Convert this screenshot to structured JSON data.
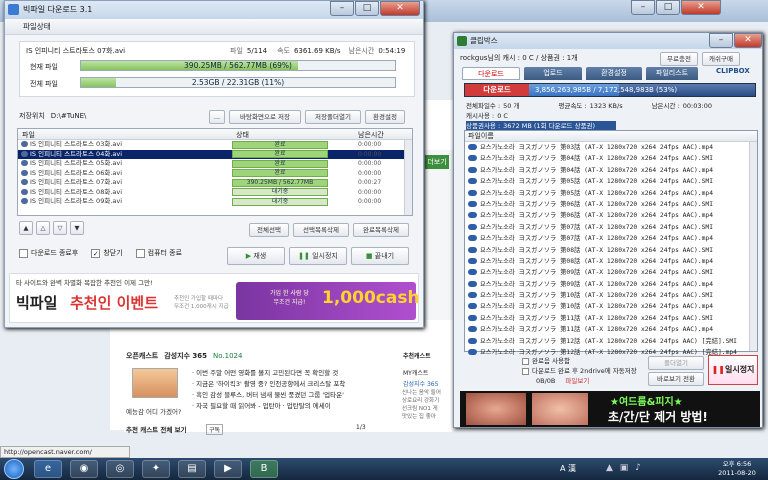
{
  "bigfile": {
    "title": "빅파일 다운로드 3.1",
    "section_label": "파일상태",
    "current_file_name": "IS 인피니티 스트라토스 07화.avi",
    "file_count_label": "파일",
    "file_count": "5/114",
    "speed_label": "속도",
    "speed": "6361.69 KB/s",
    "remain_label": "남은시간",
    "remain": "0:54:19",
    "current_file_label": "현재 파일",
    "current_progress_text": "390.25MB / 562.77MB (69%)",
    "current_progress": 0.69,
    "total_file_label": "전체 파일",
    "total_progress_text": "2.53GB / 22.31GB (11%)",
    "total_progress": 0.11,
    "save_location_label": "저장위치",
    "save_path": "D:\\#TuNE\\",
    "browse_label": "...",
    "btn_icon_save": "바탕화면으로 저장",
    "btn_folder_save": "저장폴더열기",
    "btn_settings": "환경설정",
    "col_file": "파일",
    "col_status": "상태",
    "col_remain": "남은시간",
    "rows": [
      {
        "name": "IS 인피니티 스트라토스 03화.avi",
        "status": "완료",
        "time": "0:00:00",
        "progress": 1
      },
      {
        "name": "IS 인피니티 스트라토스 04화.avi",
        "status": "완료",
        "time": "0:00:00",
        "progress": 1
      },
      {
        "name": "IS 인피니티 스트라토스 05화.avi",
        "status": "완료",
        "time": "0:00:00",
        "progress": 1
      },
      {
        "name": "IS 인피니티 스트라토스 06화.avi",
        "status": "완료",
        "time": "0:00:00",
        "progress": 1
      },
      {
        "name": "IS 인피니티 스트라토스 07화.avi",
        "status": "390.25MB / 562.77MB",
        "time": "0:00:27",
        "progress": 0.69
      },
      {
        "name": "IS 인피니티 스트라토스 08화.avi",
        "status": "대기중",
        "time": "0:00:00",
        "progress": 0
      },
      {
        "name": "IS 인피니티 스트라토스 09화.avi",
        "status": "대기중",
        "time": "0:00:00",
        "progress": 0
      }
    ],
    "btn_select_all": "전체선택",
    "btn_delete_selected": "선택목록삭제",
    "btn_delete_done": "완료목록삭제",
    "chk_close": "다운로드 종료후",
    "chk_minimize": "창닫기",
    "chk_shutdown": "컴퓨터 종료",
    "btn_play": "재생",
    "btn_pause": "일시정지",
    "btn_close": "끝내기",
    "ad_top": "타 사이트와 완벽 차별화 복잡한 추천인 이제 그만!",
    "ad_brand": "빅파일",
    "ad_main": "추천인 이벤트",
    "ad_sub": "추천인 가입할 때마다\n무조건 1,000캐시 지급",
    "ad_promo": "가입 한 사람 당\n무조건 지급!",
    "ad_cash": "1,000cash"
  },
  "clipbox": {
    "title": "클립박스",
    "user_line": "rockgus님의 캐시 : 0 C / 상품권 : 1개",
    "btn_charge": "무료충전",
    "btn_cash_charge": "캐쉬구매",
    "tabs": [
      "다운로드",
      "업로드",
      "환경설정",
      "파일리스트"
    ],
    "brand": "CLIPBOX",
    "header_text": "다운로드",
    "header_progress": "3,856,263,985B / 7,172,548,983B (53%)",
    "header_progress_value": 0.53,
    "total_files_label": "전체파일수 :",
    "total_files": "50 개",
    "avg_speed_label": "평균속도 :",
    "avg_speed": "1323 KB/s",
    "remain_label": "남은시간 :",
    "remain": "00:03:00",
    "cache_label": "캐시사용 :",
    "cache": "0 C",
    "free_label": "상품권사용 :",
    "free_value": "3672 MB (1회 다운로드 상품권)",
    "list_header": "파일이름",
    "files": [
      "요스가노소라 ヨスガノソラ 第03話 (AT-X 1280x720 x264 24fps AAC).mp4",
      "요스가노소라 ヨスガノソラ 第04話 (AT-X 1280x720 x264 24fps AAC).SMI",
      "요스가노소라 ヨスガノソラ 第04話 (AT-X 1280x720 x264 24fps AAC).mp4",
      "요스가노소라 ヨスガノソラ 第05話 (AT-X 1280x720 x264 24fps AAC).SMI",
      "요스가노소라 ヨスガノソラ 第05話 (AT-X 1280x720 x264 24fps AAC).mp4",
      "요스가노소라 ヨスガノソラ 第06話 (AT-X 1280x720 x264 24fps AAC).SMI",
      "요스가노소라 ヨスガノソラ 第06話 (AT-X 1280x720 x264 24fps AAC).mp4",
      "요스가노소라 ヨスガノソラ 第07話 (AT-X 1280x720 x264 24fps AAC).SMI",
      "요스가노소라 ヨスガノソラ 第07話 (AT-X 1280x720 x264 24fps AAC).mp4",
      "요스가노소라 ヨスガノソラ 第08話 (AT-X 1280x720 x264 24fps AAC).SMI",
      "요스가노소라 ヨスガノソラ 第08話 (AT-X 1280x720 x264 24fps AAC).mp4",
      "요스가노소라 ヨスガノソラ 第09話 (AT-X 1280x720 x264 24fps AAC).SMI",
      "요스가노소라 ヨスガノソラ 第09話 (AT-X 1280x720 x264 24fps AAC).mp4",
      "요스가노소라 ヨスガノソラ 第10話 (AT-X 1280x720 x264 24fps AAC).SMI",
      "요스가노소라 ヨスガノソラ 第10話 (AT-X 1280x720 x264 24fps AAC).mp4",
      "요스가노소라 ヨスガノソラ 第11話 (AT-X 1280x720 x264 24fps AAC).SMI",
      "요스가노소라 ヨスガノソラ 第11話 (AT-X 1280x720 x264 24fps AAC).mp4",
      "요스가노소라 ヨスガノソラ 第12話 (AT-X 1280x720 x264 24fps AAC) [完結].SMI",
      "요스가노소라 ヨスガノソラ 第12話 (AT-X 1280x720 x264 24fps AAC) [完結].mp4"
    ],
    "chk_sound": "완료음 사용함",
    "chk_end": "다운로드 완료 후 2ndrive에 자동저장",
    "storage": "0B/0B",
    "extra": "파일보기",
    "btn_folder": "폴더열기",
    "btn_save": "바로보기 전환",
    "btn_stop": "일시정지",
    "ad_text1": "★여드름&피지★",
    "ad_text2": "초/간/단 제거 방법!"
  },
  "browser": {
    "news_title": "오픈캐스트",
    "news_sub": "감성지수 365",
    "news_no": "No.1024",
    "news_items": [
      "이번 주말 어떤 영화를 볼지 고민된다면 꼭 확인할 것",
      "지금은 '하이킥3' 촬영 중? 인천공항에서 크리스탈 포착",
      "흑인 감성 블루스, 버터 냄새 물씬 풍겼던 그룹 '업타운'",
      "자국 필요할 때 읽어봐 - 업탄아 · 업탄탈의 에세이"
    ],
    "news_caption": "예능감 어디 가겠어?",
    "news_more": "추천 캐스트 전체 보기",
    "news_sub_label": "구독",
    "news_page": "1/3",
    "side_title": "추천캐스트",
    "side_my": "MY캐스트",
    "side_sub": "감성지수 365",
    "side_items": [
      "신나는 음악 들어",
      "상로요리 강화기",
      "선크림 NO1 게",
      "맛있는 집 좋아"
    ],
    "status_url": "http://opencast.naver.com/"
  },
  "taskbar": {
    "lang": "A 漢",
    "time": "오후 6:56",
    "date": "2011-08-20"
  }
}
